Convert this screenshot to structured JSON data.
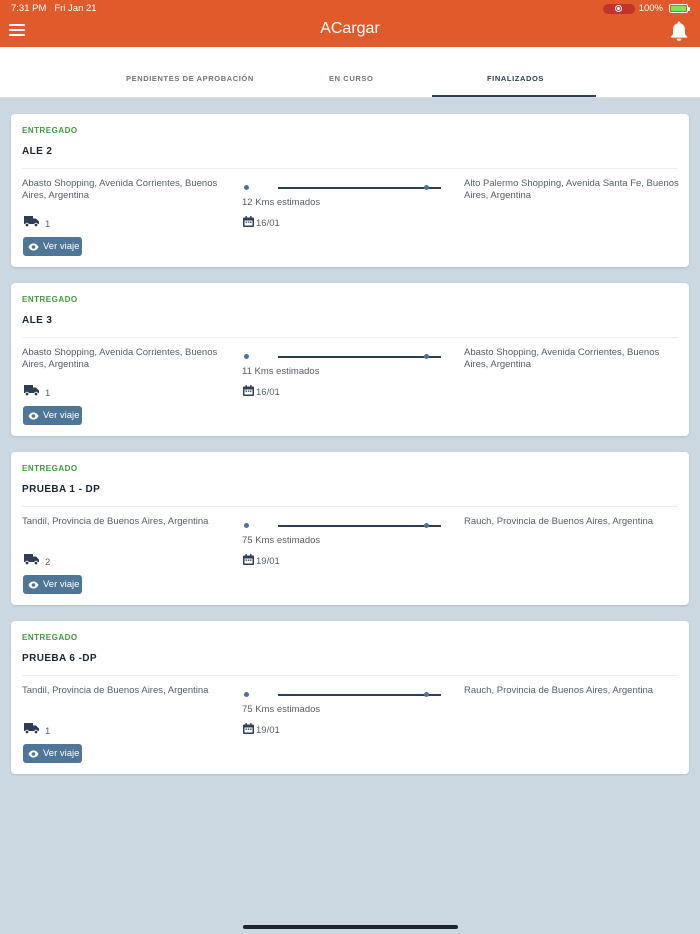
{
  "status_bar": {
    "time": "7:31 PM",
    "date": "Fri Jan 21",
    "battery": "100%"
  },
  "header": {
    "title": "ACargar",
    "menu_icon": "hamburger-menu-icon",
    "bell_icon": "bell-icon"
  },
  "tabs": [
    {
      "label": "PENDIENTES DE APROBACIÓN"
    },
    {
      "label": "EN CURSO"
    },
    {
      "label": "FINALIZADOS",
      "active": true
    }
  ],
  "trips": [
    {
      "status": "ENTREGADO",
      "name": "ALE 2",
      "origin": "Abasto Shopping, Avenida Corrientes, Buenos Aires, Argentina",
      "destination": "Alto Palermo Shopping, Avenida Santa Fe, Buenos Aires, Argentina",
      "distance": "12 Kms estimados",
      "trucks": "1",
      "date": "16/01",
      "button": "Ver viaje"
    },
    {
      "status": "ENTREGADO",
      "name": "ALE 3",
      "origin": "Abasto Shopping, Avenida Corrientes, Buenos Aires, Argentina",
      "destination": "Abasto Shopping, Avenida Corrientes, Buenos Aires, Argentina",
      "distance": "11 Kms estimados",
      "trucks": "1",
      "date": "16/01",
      "button": "Ver viaje"
    },
    {
      "status": "ENTREGADO",
      "name": "PRUEBA 1 - DP",
      "origin": "Tandil, Provincia de Buenos Aires, Argentina",
      "destination": "Rauch, Provincia de Buenos Aires, Argentina",
      "distance": "75 Kms estimados",
      "trucks": "2",
      "date": "19/01",
      "button": "Ver viaje"
    },
    {
      "status": "ENTREGADO",
      "name": "PRUEBA 6 -DP",
      "origin": "Tandil, Provincia de Buenos Aires, Argentina",
      "destination": "Rauch, Provincia de Buenos Aires, Argentina",
      "distance": "75 Kms estimados",
      "trucks": "1",
      "date": "19/01",
      "button": "Ver viaje"
    }
  ],
  "colors": {
    "header": "#e15a2b",
    "status_delivered": "#3e9d3a",
    "button": "#4f7597",
    "background": "#cbd8e1"
  }
}
